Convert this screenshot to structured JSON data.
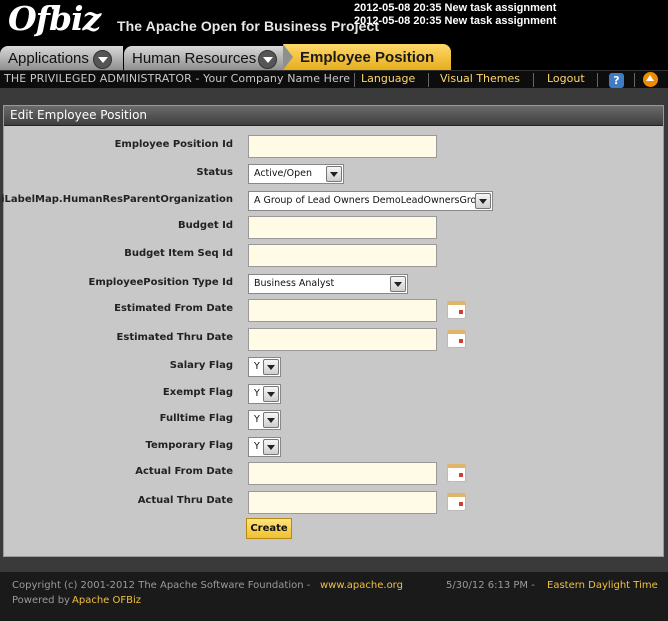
{
  "header": {
    "logo_text": "Ofbiz",
    "site_title": "The Apache Open for Business Project",
    "notifications": [
      "2012-05-08 20:35 New task assignment",
      "2012-05-08 20:35 New task assignment"
    ]
  },
  "tabs": {
    "applications": "Applications",
    "human_resources": "Human Resources",
    "employee_position": "Employee Position"
  },
  "userbar": {
    "user_info": "THE PRIVILEGED ADMINISTRATOR - Your Company Name Here",
    "language": "Language",
    "visual_themes": "Visual Themes",
    "logout": "Logout",
    "help": "?"
  },
  "form": {
    "title": "Edit Employee Position",
    "fields": {
      "employee_position_id": {
        "label": "Employee Position Id",
        "value": ""
      },
      "status": {
        "label": "Status",
        "value": "Active/Open"
      },
      "parent_org": {
        "label": "${uiLabelMap.HumanResParentOrganization",
        "value": "A Group of Lead Owners DemoLeadOwnersGroup"
      },
      "budget_id": {
        "label": "Budget Id",
        "value": ""
      },
      "budget_item_seq_id": {
        "label": "Budget Item Seq Id",
        "value": ""
      },
      "type_id": {
        "label": "EmployeePosition Type Id",
        "value": "Business Analyst"
      },
      "est_from_date": {
        "label": "Estimated From Date",
        "value": ""
      },
      "est_thru_date": {
        "label": "Estimated Thru Date",
        "value": ""
      },
      "salary_flag": {
        "label": "Salary Flag",
        "value": "Y"
      },
      "exempt_flag": {
        "label": "Exempt Flag",
        "value": "Y"
      },
      "fulltime_flag": {
        "label": "Fulltime Flag",
        "value": "Y"
      },
      "temporary_flag": {
        "label": "Temporary Flag",
        "value": "Y"
      },
      "actual_from_date": {
        "label": "Actual From Date",
        "value": ""
      },
      "actual_thru_date": {
        "label": "Actual Thru Date",
        "value": ""
      }
    },
    "create_label": "Create"
  },
  "footer": {
    "copyright": "Copyright (c) 2001-2012 The Apache Software Foundation - ",
    "apache_link": "www.apache.org",
    "powered_by": "Powered by ",
    "ofbiz_link": "Apache OFBiz",
    "datetime": "5/30/12 6:13 PM - ",
    "timezone": "Eastern Daylight Time"
  }
}
